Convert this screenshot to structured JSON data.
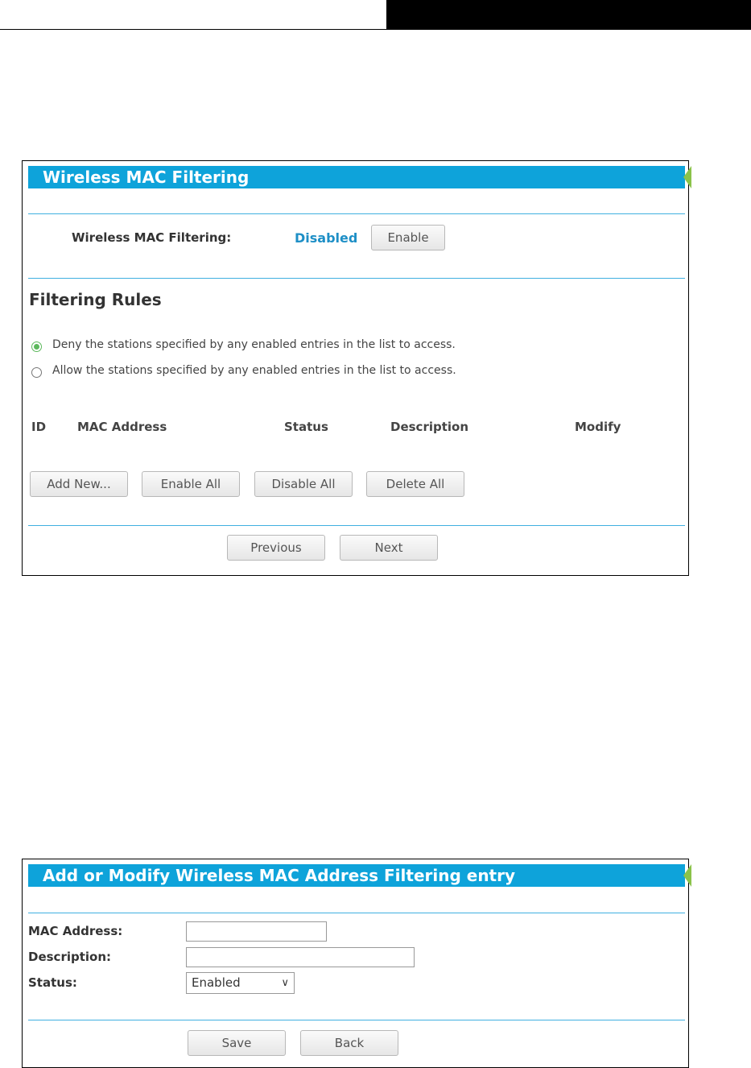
{
  "panel1": {
    "title": "Wireless MAC Filtering",
    "filtering_label": "Wireless MAC Filtering:",
    "filtering_status": "Disabled",
    "enable_button": "Enable",
    "section_title": "Filtering Rules",
    "rules": [
      {
        "label": "Deny the stations specified by any enabled entries in the list to access.",
        "selected": true
      },
      {
        "label": "Allow the stations specified by any enabled entries in the list to access.",
        "selected": false
      }
    ],
    "table_headers": {
      "id": "ID",
      "mac": "MAC Address",
      "status": "Status",
      "description": "Description",
      "modify": "Modify"
    },
    "buttons": {
      "add_new": "Add New...",
      "enable_all": "Enable All",
      "disable_all": "Disable All",
      "delete_all": "Delete All"
    },
    "nav": {
      "previous": "Previous",
      "next": "Next"
    }
  },
  "panel2": {
    "title": "Add or Modify Wireless MAC Address Filtering entry",
    "mac_label": "MAC Address:",
    "mac_value": "",
    "description_label": "Description:",
    "description_value": "",
    "status_label": "Status:",
    "status_value": "Enabled",
    "save_button": "Save",
    "back_button": "Back"
  },
  "colors": {
    "title_bar": "#0ea3da",
    "status_text": "#1e8fc6",
    "radio_selected": "#5cb85c",
    "accent_notch": "#8bc34a"
  }
}
